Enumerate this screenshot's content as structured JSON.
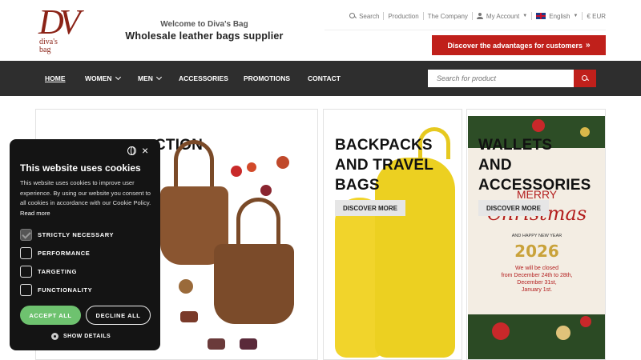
{
  "brand": {
    "logo_letters": "DV",
    "logo_text_line1": "diva's",
    "logo_text_line2": "bag",
    "welcome": "Welcome to Diva's Bag",
    "tagline": "Wholesale leather bags supplier"
  },
  "topnav": {
    "search": "Search",
    "production": "Production",
    "company": "The Company",
    "account": "My Account",
    "language": "English",
    "currency": "€ EUR"
  },
  "cta": {
    "label": "Discover the advantages for customers",
    "chevron": "»"
  },
  "mainnav": {
    "home": "HOME",
    "women": "WOMEN",
    "men": "MEN",
    "accessories": "ACCESSORIES",
    "promotions": "PROMOTIONS",
    "contact": "CONTACT"
  },
  "search": {
    "placeholder": "Search for product"
  },
  "cards": {
    "card1_title_visible": "CTION",
    "card2_title": [
      "BACKPACKS",
      "AND TRAVEL",
      "BAGS"
    ],
    "card2_button": "DISCOVER MORE",
    "card3_title": [
      "WALLETS",
      "AND",
      "ACCESSORIES"
    ],
    "card3_button": "DISCOVER MORE",
    "xmas_merry": "MERRY",
    "xmas_christmas": "Christmas",
    "xmas_newyear": "AND HAPPY NEW YEAR",
    "xmas_year": "2026",
    "xmas_closed_1": "We will be closed",
    "xmas_closed_2": "from December 24th to 28th,",
    "xmas_closed_3": "December 31st,",
    "xmas_closed_4": "January 1st."
  },
  "cookie": {
    "title": "This website uses cookies",
    "body": "This website uses cookies to improve user experience. By using our website you consent to all cookies in accordance with our Cookie Policy.",
    "read_more": "Read more",
    "options": [
      "STRICTLY NECESSARY",
      "PERFORMANCE",
      "TARGETING",
      "FUNCTIONALITY"
    ],
    "accept": "ACCEPT ALL",
    "decline": "DECLINE ALL",
    "details": "SHOW DETAILS",
    "close": "×"
  },
  "colors": {
    "brand_red": "#c0201b",
    "nav_bg": "#2e2e2e",
    "logo": "#8b2317",
    "accept_green": "#6ec26f"
  }
}
